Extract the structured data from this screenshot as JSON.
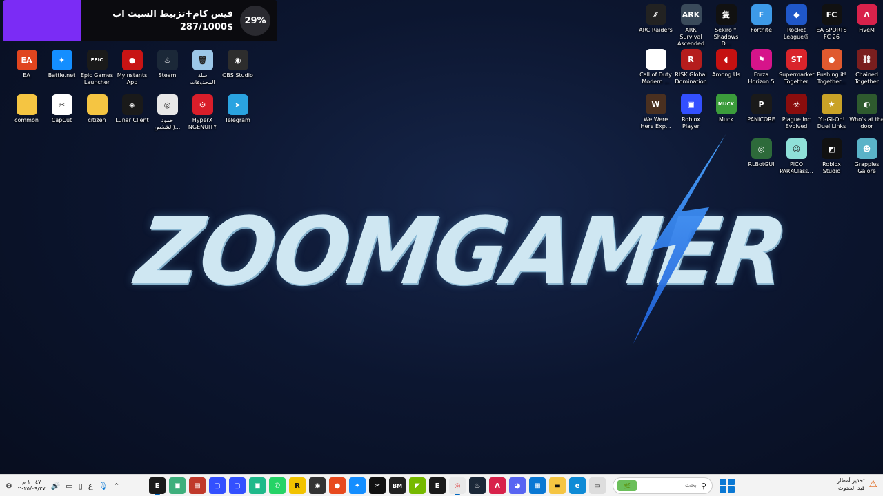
{
  "goal": {
    "title": "فيس كام+تزبيط السيت اب",
    "amount": "287/1000$",
    "percent": "29%",
    "progress": 0.287,
    "accent": "#7b2cf5"
  },
  "desktop_left": [
    {
      "label": "EA",
      "icon": "ea-icon",
      "bg": "#e0451f",
      "glyph": "EA"
    },
    {
      "label": "Battle.net",
      "icon": "battlenet-icon",
      "bg": "#148eff",
      "glyph": "✦"
    },
    {
      "label": "Epic Games Launcher",
      "icon": "epic-games-icon",
      "bg": "#1a1a1a",
      "glyph": "EPIC"
    },
    {
      "label": "Myinstants App",
      "icon": "myinstants-icon",
      "bg": "#c81414",
      "glyph": "●"
    },
    {
      "label": "Steam",
      "icon": "steam-icon",
      "bg": "#1b2838",
      "glyph": "♨"
    },
    {
      "label": "سلة المحذوفات",
      "icon": "recycle-bin-icon",
      "bg": "#9cc7e8",
      "glyph": "🗑"
    },
    {
      "label": "OBS Studio",
      "icon": "obs-icon",
      "bg": "#2d2d2d",
      "glyph": "◉"
    },
    {
      "label": "common",
      "icon": "folder-icon",
      "bg": "#f5c542",
      "glyph": ""
    },
    {
      "label": "CapCut",
      "icon": "capcut-icon",
      "bg": "#ffffff",
      "glyph": "✂"
    },
    {
      "label": "citizen",
      "icon": "folder-icon",
      "bg": "#f5c542",
      "glyph": ""
    },
    {
      "label": "Lunar Client",
      "icon": "lunar-client-icon",
      "bg": "#1a1a1a",
      "glyph": "◈"
    },
    {
      "label": "حمود (الشخص...",
      "icon": "chrome-icon",
      "bg": "#e8e8e8",
      "glyph": "◎"
    },
    {
      "label": "HyperX NGENUITY",
      "icon": "hyperx-icon",
      "bg": "#d91e2a",
      "glyph": "⚙"
    },
    {
      "label": "Telegram",
      "icon": "telegram-icon",
      "bg": "#2aa3e0",
      "glyph": "➤"
    }
  ],
  "desktop_right": [
    {
      "label": "ARC Raiders",
      "icon": "arc-raiders-icon",
      "bg": "#222",
      "glyph": "⁄⁄"
    },
    {
      "label": "ARK Survival Ascended",
      "icon": "ark-icon",
      "bg": "#3a4a5a",
      "glyph": "ARK"
    },
    {
      "label": "Sekiro™ Shadows D...",
      "icon": "sekiro-icon",
      "bg": "#111",
      "glyph": "隻"
    },
    {
      "label": "Fortnite",
      "icon": "fortnite-icon",
      "bg": "#3d9ae8",
      "glyph": "F"
    },
    {
      "label": "Rocket League®",
      "icon": "rocket-league-icon",
      "bg": "#1f57c8",
      "glyph": "◆"
    },
    {
      "label": "EA SPORTS FC 26",
      "icon": "ea-fc-icon",
      "bg": "#111",
      "glyph": "FC"
    },
    {
      "label": "FiveM",
      "icon": "fivem-icon",
      "bg": "#d8224b",
      "glyph": "Λ"
    },
    {
      "label": "Call of Duty Modern ...",
      "icon": "file-icon",
      "bg": "#ffffff",
      "glyph": ""
    },
    {
      "label": "RISK Global Domination",
      "icon": "risk-icon",
      "bg": "#b51d1d",
      "glyph": "R"
    },
    {
      "label": "Among Us",
      "icon": "among-us-icon",
      "bg": "#c51111",
      "glyph": "◖"
    },
    {
      "label": "Forza Horizon 5",
      "icon": "forza-icon",
      "bg": "#d6148a",
      "glyph": "⚑"
    },
    {
      "label": "Supermarket Together",
      "icon": "supermarket-icon",
      "bg": "#d9242b",
      "glyph": "ST"
    },
    {
      "label": "Pushing it! Together...",
      "icon": "pushing-it-icon",
      "bg": "#e05a2f",
      "glyph": "●"
    },
    {
      "label": "Chained Together",
      "icon": "chained-together-icon",
      "bg": "#7a1e1e",
      "glyph": "⛓"
    },
    {
      "label": "We Were Here Exp...",
      "icon": "we-were-here-icon",
      "bg": "#4a3020",
      "glyph": "W"
    },
    {
      "label": "Roblox Player",
      "icon": "roblox-player-icon",
      "bg": "#3350ff",
      "glyph": "▣"
    },
    {
      "label": "Muck",
      "icon": "muck-icon",
      "bg": "#3b9c3b",
      "glyph": "MUCK"
    },
    {
      "label": "PANICORE",
      "icon": "panicore-icon",
      "bg": "#1a1a1a",
      "glyph": "P"
    },
    {
      "label": "Plague Inc Evolved",
      "icon": "plague-inc-icon",
      "bg": "#8a0d0d",
      "glyph": "☣"
    },
    {
      "label": "Yu-Gi-Oh! Duel Links",
      "icon": "yugioh-icon",
      "bg": "#c9a227",
      "glyph": "★"
    },
    {
      "label": "Who's at the door",
      "icon": "whos-at-door-icon",
      "bg": "#2e5a2e",
      "glyph": "◐"
    },
    {
      "label": "",
      "icon": "",
      "bg": "",
      "glyph": "",
      "empty": true
    },
    {
      "label": "",
      "icon": "",
      "bg": "",
      "glyph": "",
      "empty": true
    },
    {
      "label": "",
      "icon": "",
      "bg": "",
      "glyph": "",
      "empty": true
    },
    {
      "label": "RLBotGUI",
      "icon": "rlbot-icon",
      "bg": "#2d6a3a",
      "glyph": "◎"
    },
    {
      "label": "PICO PARKClass...",
      "icon": "pico-park-icon",
      "bg": "#8fe0d8",
      "glyph": "☺"
    },
    {
      "label": "Roblox Studio",
      "icon": "roblox-studio-icon",
      "bg": "#111",
      "glyph": "◩"
    },
    {
      "label": "Grapples Galore",
      "icon": "grapples-galore-icon",
      "bg": "#5ab3c8",
      "glyph": "☻"
    }
  ],
  "wallpaper": {
    "logo_text": "ZOOMGAMER"
  },
  "taskbar": {
    "clock_time": "١٠:٤٧ م",
    "clock_date": "٢٠٢٥/٠٩/٢٧",
    "lang": "ع",
    "search_placeholder": "بحث",
    "weather_line1": "تحذير أمطار",
    "weather_line2": "قيد الحدوث",
    "apps": [
      {
        "name": "epic-games",
        "bg": "#1a1a1a",
        "glyph": "E",
        "color": "#fff",
        "active": true
      },
      {
        "name": "app-green",
        "bg": "#3eaf7c",
        "glyph": "▣",
        "color": "#fff"
      },
      {
        "name": "app-red-card",
        "bg": "#c0392b",
        "glyph": "▤",
        "color": "#fff"
      },
      {
        "name": "roblox-player",
        "bg": "#3350ff",
        "glyph": "▢",
        "color": "#fff"
      },
      {
        "name": "roblox-player-2",
        "bg": "#3350ff",
        "glyph": "▢",
        "color": "#fff"
      },
      {
        "name": "app-teal",
        "bg": "#1fb98a",
        "glyph": "▣",
        "color": "#fff"
      },
      {
        "name": "whatsapp",
        "bg": "#25d366",
        "glyph": "✆",
        "color": "#fff"
      },
      {
        "name": "rockstar",
        "bg": "#f2c300",
        "glyph": "R",
        "color": "#111"
      },
      {
        "name": "app-dark-circle",
        "bg": "#333",
        "glyph": "◉",
        "color": "#fff"
      },
      {
        "name": "app-red-orange",
        "bg": "#e84a1e",
        "glyph": "●",
        "color": "#fff"
      },
      {
        "name": "battle-net",
        "bg": "#148eff",
        "glyph": "✦",
        "color": "#fff"
      },
      {
        "name": "capcut",
        "bg": "#111",
        "glyph": "✂",
        "color": "#fff"
      },
      {
        "name": "app-bm",
        "bg": "#222",
        "glyph": "BM",
        "color": "#fff"
      },
      {
        "name": "nvidia",
        "bg": "#76b900",
        "glyph": "◤",
        "color": "#fff"
      },
      {
        "name": "epic-games-2",
        "bg": "#1a1a1a",
        "glyph": "E",
        "color": "#fff"
      },
      {
        "name": "chrome",
        "bg": "#e8e8e8",
        "glyph": "◎",
        "color": "#d33",
        "active": true
      },
      {
        "name": "steam",
        "bg": "#1b2838",
        "glyph": "♨",
        "color": "#fff"
      },
      {
        "name": "fivem",
        "bg": "#d8224b",
        "glyph": "Λ",
        "color": "#fff"
      },
      {
        "name": "discord",
        "bg": "#5865f2",
        "glyph": "◕",
        "color": "#fff"
      },
      {
        "name": "microsoft-store",
        "bg": "#0a78d4",
        "glyph": "▦",
        "color": "#fff"
      },
      {
        "name": "file-explorer",
        "bg": "#f5c542",
        "glyph": "▬",
        "color": "#111"
      },
      {
        "name": "edge",
        "bg": "#0f8bd6",
        "glyph": "e",
        "color": "#fff"
      },
      {
        "name": "app-window",
        "bg": "#ddd",
        "glyph": "▭",
        "color": "#333"
      }
    ]
  }
}
